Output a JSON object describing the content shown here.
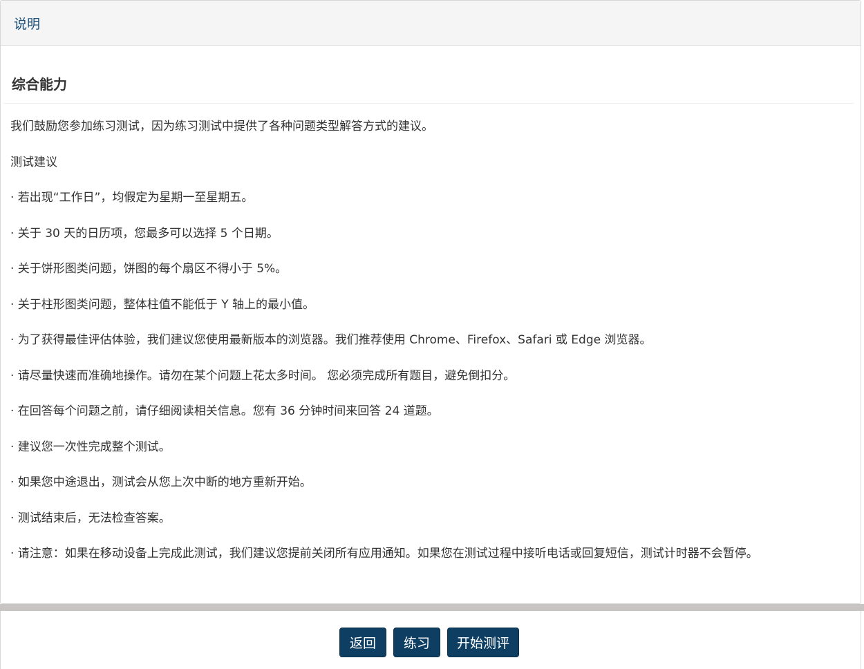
{
  "header": {
    "title": "说明"
  },
  "section": {
    "title": "综合能力"
  },
  "content": {
    "paragraphs": [
      "我们鼓励您参加练习测试，因为练习测试中提供了各种问题类型解答方式的建议。",
      "测试建议",
      "· 若出现“工作日”，均假定为星期一至星期五。",
      "· 关于 30 天的日历项，您最多可以选择 5 个日期。",
      "· 关于饼形图类问题，饼图的每个扇区不得小于 5%。",
      "· 关于柱形图类问题，整体柱值不能低于 Y 轴上的最小值。",
      "· 为了获得最佳评估体验，我们建议您使用最新版本的浏览器。我们推荐使用 Chrome、Firefox、Safari 或 Edge 浏览器。",
      "· 请尽量快速而准确地操作。请勿在某个问题上花太多时间。 您必须完成所有题目，避免倒扣分。",
      "· 在回答每个问题之前，请仔细阅读相关信息。您有 36 分钟时间来回答 24 道题。",
      "· 建议您一次性完成整个测试。",
      "· 如果您中途退出，测试会从您上次中断的地方重新开始。",
      "· 测试结束后，无法检查答案。",
      "· 请注意：如果在移动设备上完成此测试，我们建议您提前关闭所有应用通知。如果您在测试过程中接听电话或回复短信，测试计时器不会暂停。"
    ]
  },
  "footer": {
    "back_label": "返回",
    "practice_label": "练习",
    "start_label": "开始测评"
  },
  "colors": {
    "header_text": "#1a4f7a",
    "button_bg": "#0e3f63",
    "button_text": "#ffffff"
  }
}
